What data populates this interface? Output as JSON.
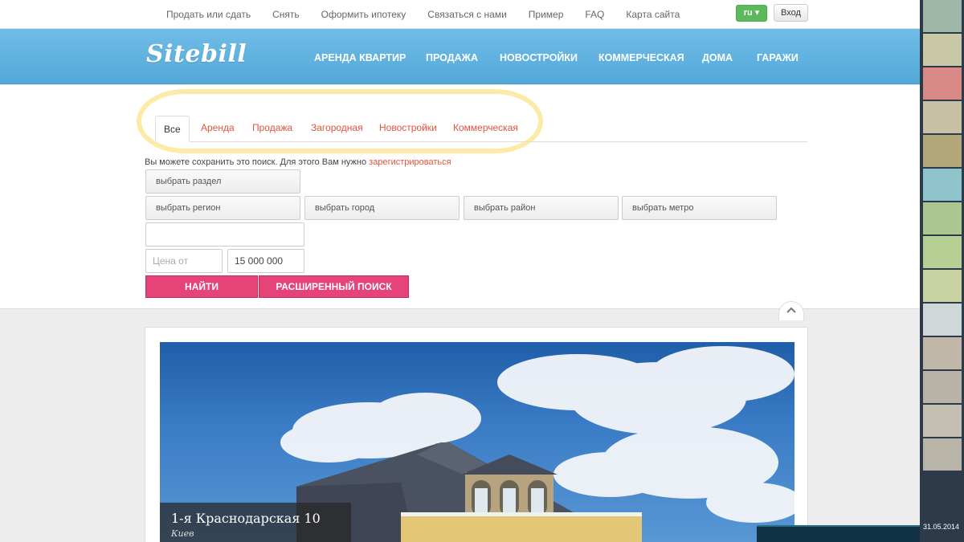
{
  "topbar": {
    "links": [
      "Продать или сдать",
      "Снять",
      "Оформить ипотеку",
      "Связаться с нами",
      "Пример",
      "FAQ",
      "Карта сайта"
    ],
    "lang": "ru ▾",
    "login": "Вход"
  },
  "header": {
    "logo": "Sitebill",
    "nav": [
      "АРЕНДА КВАРТИР",
      "ПРОДАЖА",
      "НОВОСТРОЙКИ",
      "КОММЕРЧЕСКАЯ",
      "ДОМА",
      "ГАРАЖИ"
    ]
  },
  "search": {
    "tabs": [
      "Все",
      "Аренда",
      "Продажа",
      "Загородная",
      "Новостройки",
      "Коммерческая"
    ],
    "active_tab": "Все",
    "save_note": "Вы можете сохранить это поиск. Для этого Вам нужно ",
    "register_link": "зарегистрироваться",
    "section_select": "выбрать раздел",
    "region_select": "выбрать регион",
    "city_select": "выбрать город",
    "district_select": "выбрать район",
    "metro_select": "выбрать метро",
    "text_input_value": "",
    "price_from_placeholder": "Цена от",
    "price_to_value": "15 000 000",
    "find_button": "НАЙТИ",
    "advanced_button": "РАСШИРЕННЫЙ ПОИСК",
    "collapse_icon": "chevron-up-icon"
  },
  "listing": {
    "title": "1-я Краснодарская 10",
    "city": "Киев"
  },
  "desktop": {
    "date": "31.05.2014"
  },
  "colors": {
    "accent": "#e64378",
    "link": "#e5533b",
    "header": "#5cb0df"
  }
}
